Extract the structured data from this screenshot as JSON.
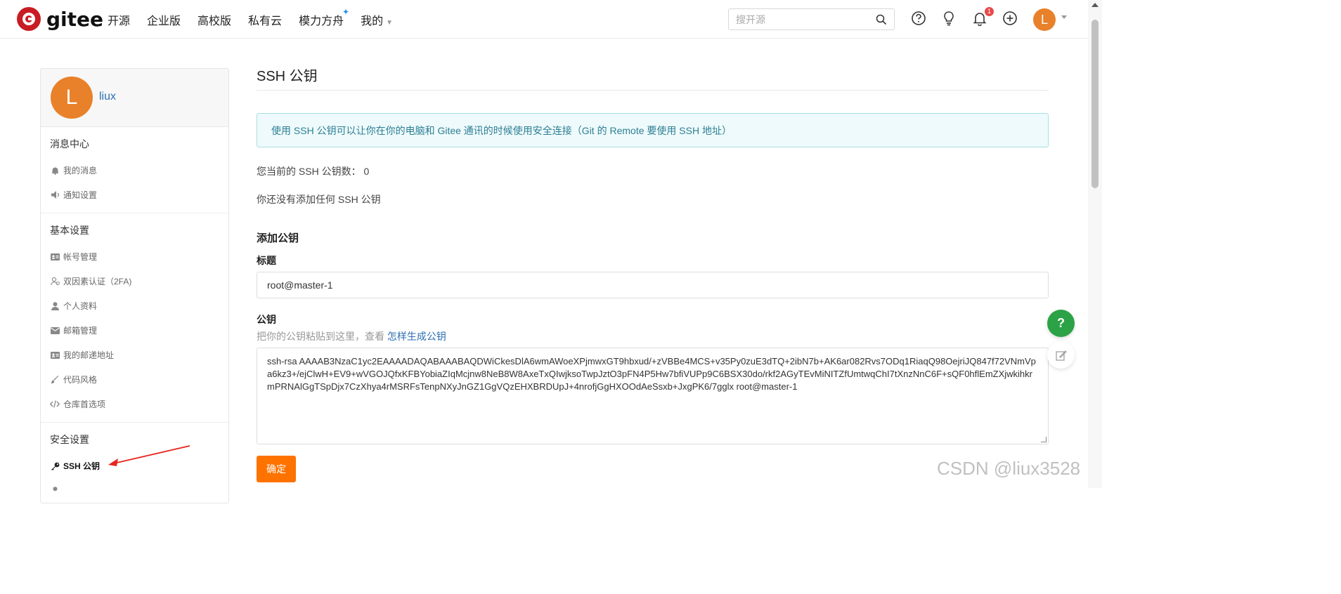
{
  "header": {
    "logo_text": "gitee",
    "nav": [
      "开源",
      "企业版",
      "高校版",
      "私有云",
      "模力方舟",
      "我的"
    ],
    "search_placeholder": "搜开源",
    "notification_count": "1",
    "avatar_letter": "L"
  },
  "sidebar": {
    "avatar_letter": "L",
    "username": "liux",
    "sections": [
      {
        "title": "消息中心",
        "items": [
          "我的消息",
          "通知设置"
        ]
      },
      {
        "title": "基本设置",
        "items": [
          "帐号管理",
          "双因素认证（2FA)",
          "个人资料",
          "邮箱管理",
          "我的邮递地址",
          "代码风格",
          "仓库首选项"
        ]
      },
      {
        "title": "安全设置",
        "items": [
          "SSH 公钥"
        ]
      }
    ]
  },
  "main": {
    "title": "SSH 公钥",
    "info": "使用 SSH 公钥可以让你在你的电脑和 Gitee 通讯的时候使用安全连接（Git 的 Remote 要使用 SSH 地址）",
    "count_label": "您当前的 SSH 公钥数：",
    "count_value": "0",
    "empty": "你还没有添加任何 SSH 公钥",
    "add_title": "添加公钥",
    "title_label": "标题",
    "title_value": "root@master-1",
    "key_label": "公钥",
    "hint_text": "把你的公钥粘贴到这里，查看",
    "hint_link": "怎样生成公钥",
    "key_value": "ssh-rsa AAAAB3NzaC1yc2EAAAADAQABAAABAQDWiCkesDlA6wmAWoeXPjmwxGT9hbxud/+zVBBe4MCS+v35Py0zuE3dTQ+2ibN7b+AK6ar082Rvs7ODq1RiaqQ98OejriJQ847f72VNmVpa6kz3+/ejClwH+EV9+wVGOJQfxKFBYobiaZIqMcjnw8NeB8W8AxeTxQIwjksoTwpJztO3pFN4P5Hw7bfiVUPp9C6BSX30do/rkf2AGyTEvMiNITZfUmtwqChI7tXnzNnC6F+sQF0hflEmZXjwkihkrmPRNAlGgTSpDjx7CzXhya4rMSRFsTenpNXyJnGZ1GgVQzEHXBRDUpJ+4nrofjGgHXOOdAeSsxb+JxgPK6/7gglx root@master-1",
    "submit_label": "确定"
  },
  "floating": {
    "help": "?"
  },
  "watermark": "CSDN @liux3528"
}
